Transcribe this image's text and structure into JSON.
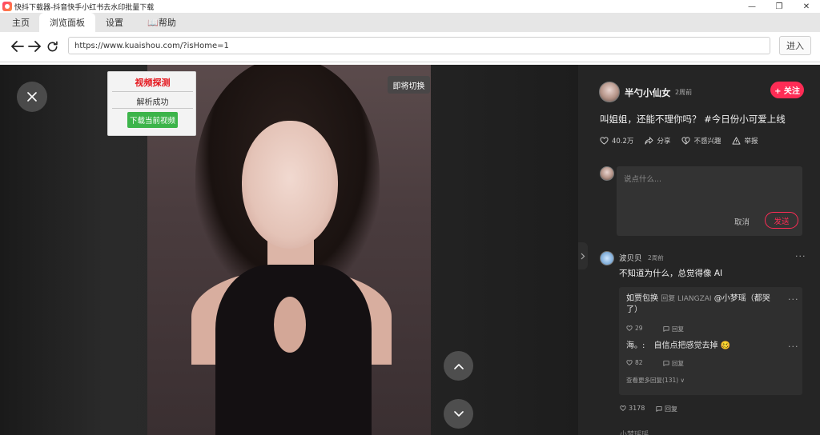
{
  "window": {
    "title": "快抖下载器-抖音快手小红书去水印批量下载",
    "controls": {
      "minimize": "—",
      "restore": "❐",
      "close": "✕"
    }
  },
  "tabs": [
    {
      "label": "主页",
      "active": false
    },
    {
      "label": "浏览面板",
      "active": true
    },
    {
      "label": "设置",
      "active": false
    },
    {
      "label": "📖帮助",
      "active": false
    }
  ],
  "navbar": {
    "url": "https://www.kuaishou.com/?isHome=1",
    "go_label": "进入"
  },
  "detect_panel": {
    "title": "视频探测",
    "status": "解析成功",
    "download_label": "下载当前视频"
  },
  "video": {
    "close_icon": "close-icon",
    "switch_label": "即将切换"
  },
  "author": {
    "name": "半勺小仙女",
    "time": "2周前",
    "follow_label": "+ 关注"
  },
  "caption": "叫姐姐，还能不理你吗？ #今日份小可爱上线",
  "actions": {
    "likes": "40.2万",
    "share": "分享",
    "not_interested": "不感兴趣",
    "report": "举报"
  },
  "comment_input": {
    "placeholder": "说点什么...",
    "cancel": "取消",
    "send": "发送"
  },
  "comment": {
    "name": "波贝贝",
    "time": "2周前",
    "text": "不知道为什么，总觉得像 AI",
    "more": "···",
    "likes": "3178",
    "reply_label": "回复"
  },
  "replies": [
    {
      "name": "如贾包换",
      "reply_to": "回复 LIANGZAI",
      "line1": "@小梦瑶（都哭",
      "line2": "了）",
      "likes": "29",
      "reply_label": "回复"
    },
    {
      "name": "海。:",
      "text": "自信点把感觉去掉 🥴",
      "likes": "82",
      "reply_label": "回复"
    }
  ],
  "see_more": "查看更多回复(131) ∨",
  "next_comment": "小梦瑶瑶"
}
